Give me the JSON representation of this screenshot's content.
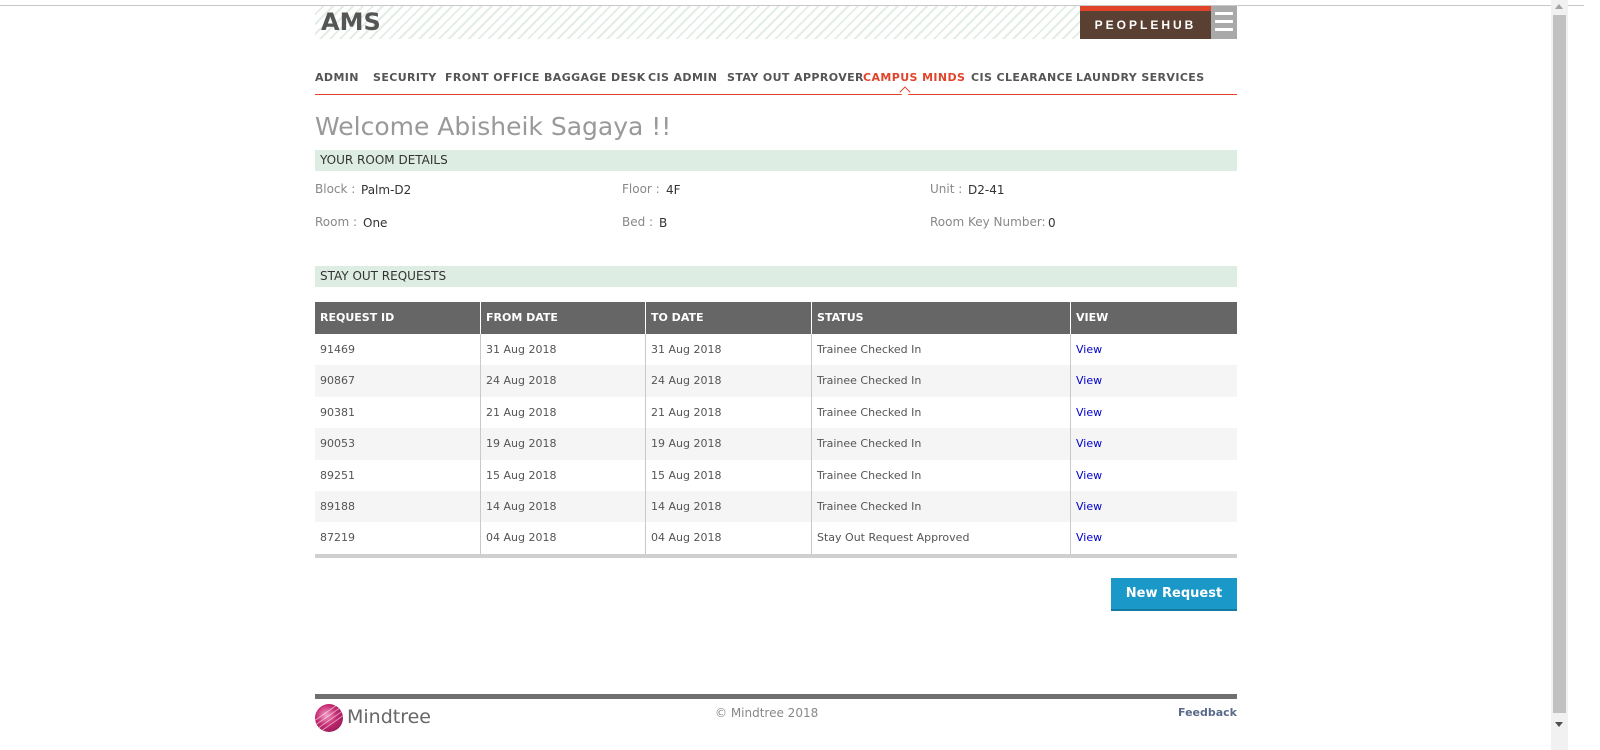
{
  "header": {
    "app_title": "AMS",
    "peoplehub_label": "PEOPLEHUB"
  },
  "nav": {
    "items": [
      {
        "label": "ADMIN"
      },
      {
        "label": "SECURITY"
      },
      {
        "label": "FRONT OFFICE"
      },
      {
        "label": "BAGGAGE DESK"
      },
      {
        "label": "CIS ADMIN"
      },
      {
        "label": "STAY OUT APPROVER"
      },
      {
        "label": "CAMPUS MINDS"
      },
      {
        "label": "CIS CLEARANCE"
      },
      {
        "label": "LAUNDRY SERVICES"
      }
    ],
    "active": "CAMPUS MINDS"
  },
  "welcome": "Welcome Abisheik Sagaya !!",
  "room_details": {
    "title": "YOUR ROOM DETAILS",
    "block_label": "Block :",
    "block_value": "Palm-D2",
    "floor_label": "Floor :",
    "floor_value": "4F",
    "unit_label": "Unit :",
    "unit_value": "D2-41",
    "room_label": "Room :",
    "room_value": "One",
    "bed_label": "Bed :",
    "bed_value": "B",
    "key_label": "Room Key Number:",
    "key_value": "0"
  },
  "requests": {
    "title": "STAY OUT REQUESTS",
    "columns": [
      "REQUEST ID",
      "FROM DATE",
      "TO DATE",
      "STATUS",
      "VIEW"
    ],
    "rows": [
      {
        "id": "91469",
        "from": "31 Aug 2018",
        "to": "31 Aug 2018",
        "status": "Trainee Checked In",
        "view": "View"
      },
      {
        "id": "90867",
        "from": "24 Aug 2018",
        "to": "24 Aug 2018",
        "status": "Trainee Checked In",
        "view": "View"
      },
      {
        "id": "90381",
        "from": "21 Aug 2018",
        "to": "21 Aug 2018",
        "status": "Trainee Checked In",
        "view": "View"
      },
      {
        "id": "90053",
        "from": "19 Aug 2018",
        "to": "19 Aug 2018",
        "status": "Trainee Checked In",
        "view": "View"
      },
      {
        "id": "89251",
        "from": "15 Aug 2018",
        "to": "15 Aug 2018",
        "status": "Trainee Checked In",
        "view": "View"
      },
      {
        "id": "89188",
        "from": "14 Aug 2018",
        "to": "14 Aug 2018",
        "status": "Trainee Checked In",
        "view": "View"
      },
      {
        "id": "87219",
        "from": "04 Aug 2018",
        "to": "04 Aug 2018",
        "status": "Stay Out Request Approved",
        "view": "View"
      }
    ],
    "new_request_label": "New Request"
  },
  "footer": {
    "brand": "Mindtree",
    "copyright": "© Mindtree 2018",
    "feedback": "Feedback"
  },
  "colors": {
    "accent": "#e0442a",
    "peoplehub_bg": "#5a3f33",
    "section_bg": "#deede4",
    "table_header_bg": "#666666",
    "button_bg": "#1a98c8",
    "link": "#0000cc"
  },
  "icons": {
    "menu": "hamburger-menu-icon",
    "logo": "mindtree-logo-icon"
  }
}
